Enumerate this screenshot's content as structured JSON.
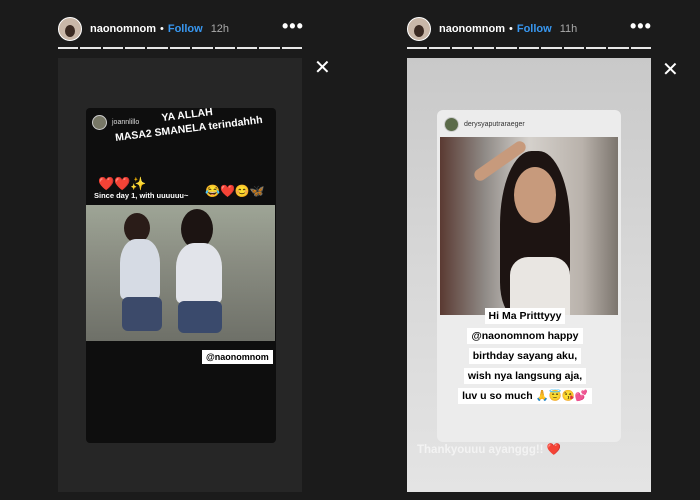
{
  "left_story": {
    "header": {
      "username": "naonomnom",
      "separator": "•",
      "follow_label": "Follow",
      "time": "12h",
      "more": "•••"
    },
    "close_glyph": "✕",
    "card_user": "joannlillo",
    "sticker_line1": "YA ALLAH",
    "sticker_line2": "MASA2 SMANELA terindahhh",
    "emoji_left": "❤️❤️✨",
    "since_text": "Since day 1, with uuuuuu~",
    "emoji_right": "😂❤️😊🦋",
    "mention": "@naonomnom",
    "segments": 11
  },
  "right_story": {
    "header": {
      "username": "naonomnom",
      "separator": "•",
      "follow_label": "Follow",
      "time": "11h",
      "more": "•••"
    },
    "close_glyph": "✕",
    "card_user": "derysyaputraraeger",
    "caption_lines": [
      "Hi Ma Pritttyyy",
      "@naonomnom happy",
      "birthday sayang aku,",
      "wish nya langsung aja,",
      "luv u so much 🙏😇😘💕"
    ],
    "reply_text": "Thankyouuu ayanggg!! ❤️",
    "segments": 11
  },
  "colors": {
    "follow": "#3897f0",
    "background": "#1b1b1b"
  }
}
